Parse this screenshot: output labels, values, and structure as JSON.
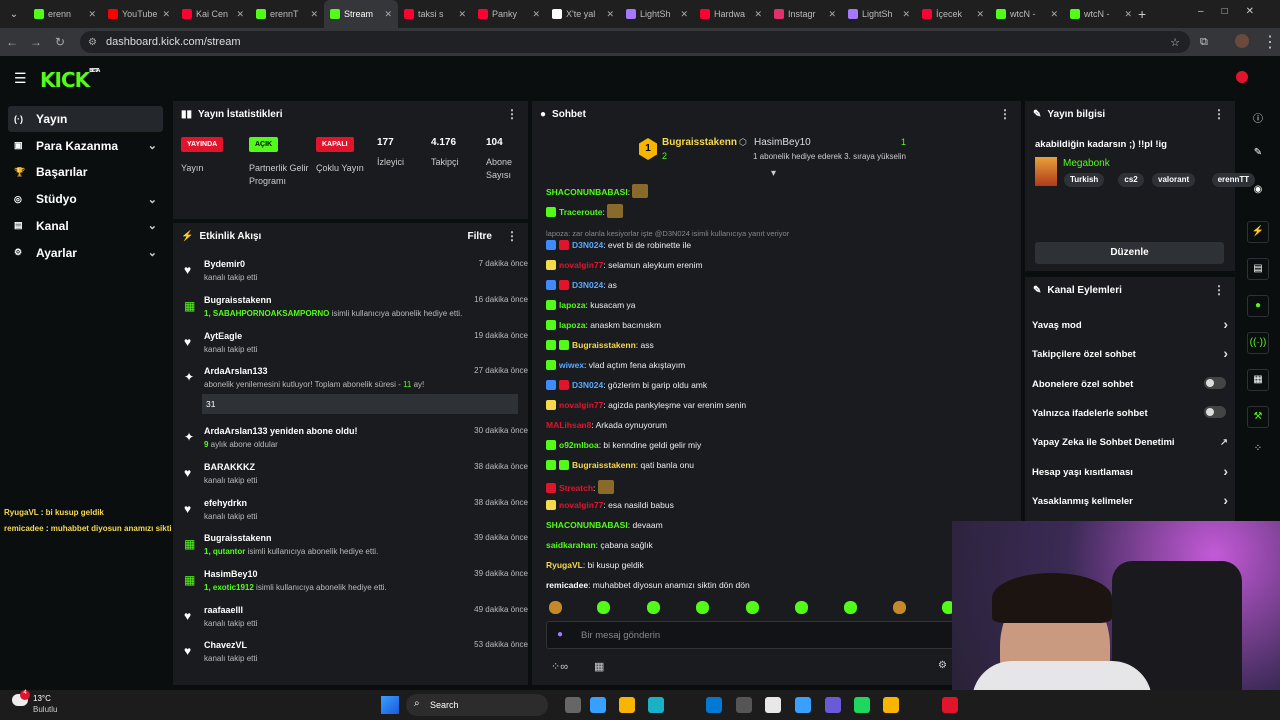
{
  "browser": {
    "tabs": [
      {
        "label": "erenn",
        "color": "#53fc18"
      },
      {
        "label": "YouTube",
        "color": "#ff0000"
      },
      {
        "label": "Kai Cen",
        "color": "#ff0033"
      },
      {
        "label": "erennT",
        "color": "#53fc18"
      },
      {
        "label": "Stream",
        "color": "#53fc18",
        "active": true
      },
      {
        "label": "taksi s",
        "color": "#ff0033"
      },
      {
        "label": "Panky",
        "color": "#ff0033"
      },
      {
        "label": "X'te yal",
        "color": "#fff"
      },
      {
        "label": "LightSh",
        "color": "#a678ff"
      },
      {
        "label": "Hardwa",
        "color": "#ff0033"
      },
      {
        "label": "Instagr",
        "color": "#e1306c"
      },
      {
        "label": "LightSh",
        "color": "#a678ff"
      },
      {
        "label": "İçecek",
        "color": "#ff0033"
      },
      {
        "label": "wtcN -",
        "color": "#53fc18"
      },
      {
        "label": "wtcN -",
        "color": "#53fc18"
      }
    ],
    "url": "dashboard.kick.com/stream"
  },
  "logo": "KICK",
  "logo_beta": "BETA",
  "sidebar": {
    "items": [
      {
        "label": "Yayın",
        "icon": "broadcast-icon",
        "glyph": "(·)",
        "selected": true
      },
      {
        "label": "Para Kazanma",
        "icon": "money-icon",
        "glyph": "▣",
        "chev": true
      },
      {
        "label": "Başarılar",
        "icon": "trophy-icon",
        "glyph": "🏆"
      },
      {
        "label": "Stüdyo",
        "icon": "studio-icon",
        "glyph": "◎",
        "chev": true
      },
      {
        "label": "Kanal",
        "icon": "channel-icon",
        "glyph": "▤",
        "chev": true
      },
      {
        "label": "Ayarlar",
        "icon": "settings-icon",
        "glyph": "⚙",
        "chev": true
      }
    ]
  },
  "overlay_chat": [
    {
      "user": "RyugaVL",
      "text": "bi kusup geldik",
      "color": "#f7d94c"
    },
    {
      "user": "remicadee",
      "text": "muhabbet diyosun anamızı siktin dön dön",
      "color": "#f7d94c"
    }
  ],
  "stats": {
    "title": "Yayın İstatistikleri",
    "cols": [
      {
        "pill": "YAYINDA",
        "pill_bg": "#e0152c",
        "label": "Yayın"
      },
      {
        "pill": "AÇIK",
        "pill_bg": "#53fc18",
        "pill_fg": "#000",
        "label": "Partnerlik Gelir Programı"
      },
      {
        "pill": "KAPALI",
        "pill_bg": "#e0152c",
        "label": "Çoklu Yayın"
      },
      {
        "num": "177",
        "label": "İzleyici"
      },
      {
        "num": "4.176",
        "label": "Takipçi"
      },
      {
        "num": "104",
        "label": "Abone Sayısı"
      }
    ]
  },
  "activity": {
    "title": "Etkinlik Akışı",
    "filter": "Filtre",
    "events": [
      {
        "name": "Bydemir0",
        "sub": "kanalı takip etti",
        "time": "7 dakika önce",
        "icon": "heart-icon",
        "glyph": "♥"
      },
      {
        "name": "Bugraisstakenn",
        "sub_hl": "1, SABAHPORNOAKSAMPORNO",
        "sub": " isimli kullanıcıya abonelik hediye etti.",
        "time": "16 dakika önce",
        "icon": "gift-icon",
        "glyph": "▦",
        "gicon": true
      },
      {
        "name": "AytEagle",
        "sub": "kanalı takip etti",
        "time": "19 dakika önce",
        "icon": "heart-icon",
        "glyph": "♥"
      },
      {
        "name": "ArdaArslan133",
        "sub": "abonelik yenilemesini kutluyor! Toplam abonelik süresi - ",
        "sub_tail": "11",
        "sub_end": " ay!",
        "time": "27 dakika önce",
        "icon": "resub-icon",
        "glyph": "✦",
        "box": "31"
      },
      {
        "name": "ArdaArslan133 yeniden abone oldu!",
        "sub_hl": "9",
        "sub": " aylık abone oldular",
        "time": "30 dakika önce",
        "icon": "sparkle-icon",
        "glyph": "✦"
      },
      {
        "name": "BARAKKKZ",
        "sub": "kanalı takip etti",
        "time": "38 dakika önce",
        "icon": "heart-icon",
        "glyph": "♥"
      },
      {
        "name": "efehydrkn",
        "sub": "kanalı takip etti",
        "time": "38 dakika önce",
        "icon": "heart-icon",
        "glyph": "♥"
      },
      {
        "name": "Bugraisstakenn",
        "sub_hl": "1, qutantor",
        "sub": " isimli kullanıcıya abonelik hediye etti.",
        "time": "39 dakika önce",
        "icon": "gift-icon",
        "glyph": "▦",
        "gicon": true
      },
      {
        "name": "HasimBey10",
        "sub_hl": "1, exotic1912",
        "sub": " isimli kullanıcıya abonelik hediye etti.",
        "time": "39 dakika önce",
        "icon": "gift-icon",
        "glyph": "▦",
        "gicon": true
      },
      {
        "name": "raafaaelll",
        "sub": "kanalı takip etti",
        "time": "49 dakika önce",
        "icon": "heart-icon",
        "glyph": "♥"
      },
      {
        "name": "ChavezVL",
        "sub": "kanalı takip etti",
        "time": "53 dakika önce",
        "icon": "heart-icon",
        "glyph": "♥"
      }
    ]
  },
  "chat": {
    "title": "Sohbet",
    "pinned": {
      "rank": "1",
      "user": "Bugraisstakenn",
      "count": "2",
      "user2": "HasimBey10",
      "count2": "1",
      "note": "1 abonelik hediye ederek 3. sıraya yükselin"
    },
    "messages": [
      {
        "user": "SHACONUNBABASI",
        "text": "",
        "color": "#53fc18",
        "emote": true
      },
      {
        "user": "Traceroute",
        "text": "",
        "color": "#53fc18",
        "badge": "#53fc18",
        "emote": true
      },
      {
        "reply": "lapoza: zar olanla kesiyorlar işte @D3N024 isimli kullanıcıya yanıt veriyor"
      },
      {
        "user": "D3N024",
        "text": "evet bi de robinette ile",
        "color": "#5aa9ff",
        "badge": "#3d8bff",
        "badge2": "#e0152c"
      },
      {
        "user": "novalgin77",
        "text": "selamun aleykum erenim",
        "color": "#e0152c",
        "badge": "#f7d94c"
      },
      {
        "user": "D3N024",
        "text": "as",
        "color": "#5aa9ff",
        "badge": "#3d8bff",
        "badge2": "#e0152c"
      },
      {
        "user": "lapoza",
        "text": "kusacam ya",
        "color": "#53fc18",
        "badge": "#53fc18"
      },
      {
        "user": "lapoza",
        "text": "anaskm bacınıskm",
        "color": "#53fc18",
        "badge": "#53fc18"
      },
      {
        "user": "Bugraisstakenn",
        "text": "ass",
        "color": "#f7d94c",
        "badge": "#53fc18",
        "badge2": "#53fc18"
      },
      {
        "user": "wiwex",
        "text": "vlad açtım fena akıştayım",
        "color": "#5aa9ff",
        "badge": "#53fc18"
      },
      {
        "user": "D3N024",
        "text": "gözlerim bi garip oldu amk",
        "color": "#5aa9ff",
        "badge": "#3d8bff",
        "badge2": "#e0152c"
      },
      {
        "user": "novalgin77",
        "text": "agizda pankyleşme var erenim senin",
        "color": "#e0152c",
        "badge": "#f7d94c"
      },
      {
        "user": "MALihsan8",
        "text": "Arkada oynuyorum",
        "color": "#e0152c"
      },
      {
        "user": "o92mlboa",
        "text": "bi kenndine geldi gelir miy",
        "color": "#53fc18",
        "badge": "#53fc18"
      },
      {
        "user": "Bugraisstakenn",
        "text": "qati banla onu",
        "color": "#f7d94c",
        "badge": "#53fc18",
        "badge2": "#53fc18"
      },
      {
        "user": "Streatch",
        "text": "",
        "color": "#e0152c",
        "badge": "#e0152c",
        "emote": true
      },
      {
        "user": "novalgin77",
        "text": "esa nasildi babus",
        "color": "#e0152c",
        "badge": "#f7d94c"
      },
      {
        "user": "SHACONUNBABASI",
        "text": "devaam",
        "color": "#53fc18"
      },
      {
        "user": "saidkarahan",
        "text": "çabana sağlık",
        "color": "#53fc18"
      },
      {
        "user": "RyugaVL",
        "text": "bi kusup geldik",
        "color": "#f7d94c"
      },
      {
        "user": "remicadee",
        "text": "muhabbet diyosun anamızı siktin dön dön",
        "color": "#ffffff"
      }
    ],
    "input_placeholder": "Bir mesaj gönderin"
  },
  "stream_info": {
    "title": "Yayın bilgisi",
    "stream_title": "akabildiğin kadarsın ;) !!pl !ig",
    "category": "Megabonk",
    "tags": [
      "Turkish",
      "cs2",
      "valorant",
      "erennTT"
    ],
    "edit": "Düzenle"
  },
  "channel_actions": {
    "title": "Kanal Eylemleri",
    "items": [
      {
        "label": "Yavaş mod",
        "ctrl": "chevron"
      },
      {
        "label": "Takipçilere özel sohbet",
        "ctrl": "chevron"
      },
      {
        "label": "Abonelere özel sohbet",
        "ctrl": "toggle"
      },
      {
        "label": "Yalnızca ifadelerle sohbet",
        "ctrl": "toggle"
      },
      {
        "label": "Yapay Zeka ile Sohbet Denetimi",
        "ctrl": "external"
      },
      {
        "label": "Hesap yaşı kısıtlaması",
        "ctrl": "chevron"
      },
      {
        "label": "Yasaklanmış kelimeler",
        "ctrl": "chevron"
      }
    ]
  },
  "taskbar": {
    "weather_temp": "13°C",
    "weather_desc": "Bulutlu",
    "search": "Search",
    "badge": "4"
  }
}
